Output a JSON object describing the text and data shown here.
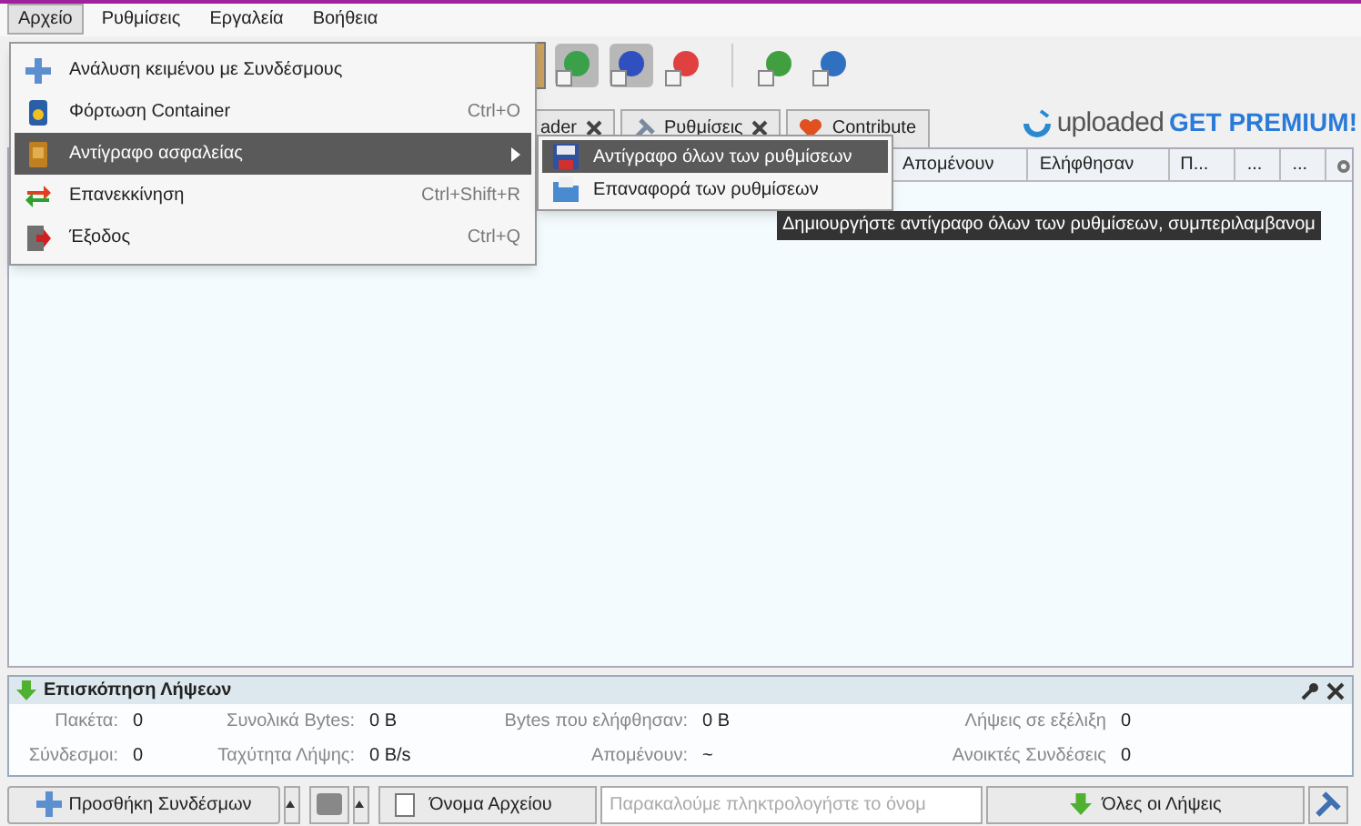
{
  "menubar": [
    {
      "label": "Αρχείο",
      "selected": true
    },
    {
      "label": "Ρυθμίσεις",
      "selected": false
    },
    {
      "label": "Εργαλεία",
      "selected": false
    },
    {
      "label": "Βοήθεια",
      "selected": false
    }
  ],
  "menu": [
    {
      "label": "Ανάλυση κειμένου με Συνδέσμους",
      "selected": false,
      "submenu": false
    },
    {
      "label": "Φόρτωση Container",
      "shortcut": "Ctrl+O",
      "selected": false,
      "submenu": false
    },
    {
      "label": "Αντίγραφο ασφαλείας",
      "selected": true,
      "submenu": true
    },
    {
      "label": "Επανεκκίνηση",
      "shortcut": "Ctrl+Shift+R",
      "selected": false,
      "submenu": false
    },
    {
      "label": "Έξοδος",
      "shortcut": "Ctrl+Q",
      "selected": false,
      "submenu": false
    }
  ],
  "submenu": [
    {
      "label": "Αντίγραφο όλων των ρυθμίσεων",
      "selected": true
    },
    {
      "label": "Επαναφορά των ρυθμίσεων",
      "selected": false
    }
  ],
  "tooltip": "Δημιουργήστε αντίγραφο όλων των ρυθμίσεων, συμπεριλαμβανομ",
  "tabs": [
    {
      "label": "ader",
      "closable": true
    },
    {
      "label": "Ρυθμίσεις",
      "closable": true
    },
    {
      "label": "Contribute",
      "closable": false
    }
  ],
  "banner": {
    "brand": "uploaded",
    "cta": "GET PREMIUM!"
  },
  "table": {
    "columns": [
      "Απομένουν",
      "Ελήφθησαν",
      "Π...",
      "...",
      "..."
    ]
  },
  "overview": {
    "title": "Επισκόπηση Λήψεων",
    "rows": [
      [
        {
          "label": "Πακέτα:",
          "value": "0"
        },
        {
          "label": "Συνολικά Bytes:",
          "value": "0 B"
        },
        {
          "label": "Bytes που ελήφθησαν:",
          "value": "0 B"
        },
        {
          "label": "Λήψεις σε εξέλιξη",
          "value": "0"
        }
      ],
      [
        {
          "label": "Σύνδεσμοι:",
          "value": "0"
        },
        {
          "label": "Ταχύτητα Λήψης:",
          "value": "0 B/s"
        },
        {
          "label": "Απομένουν:",
          "value": "~"
        },
        {
          "label": "Ανοικτές Συνδέσεις",
          "value": "0"
        }
      ]
    ]
  },
  "bottom": {
    "add_button": "Προσθήκη Συνδέσμων",
    "sort_button": "Όνομα Αρχείου",
    "search": {
      "placeholder": "Παρακαλούμε πληκτρολογήστε το όνομ"
    },
    "filter_button": "Όλες οι Λήψεις"
  }
}
